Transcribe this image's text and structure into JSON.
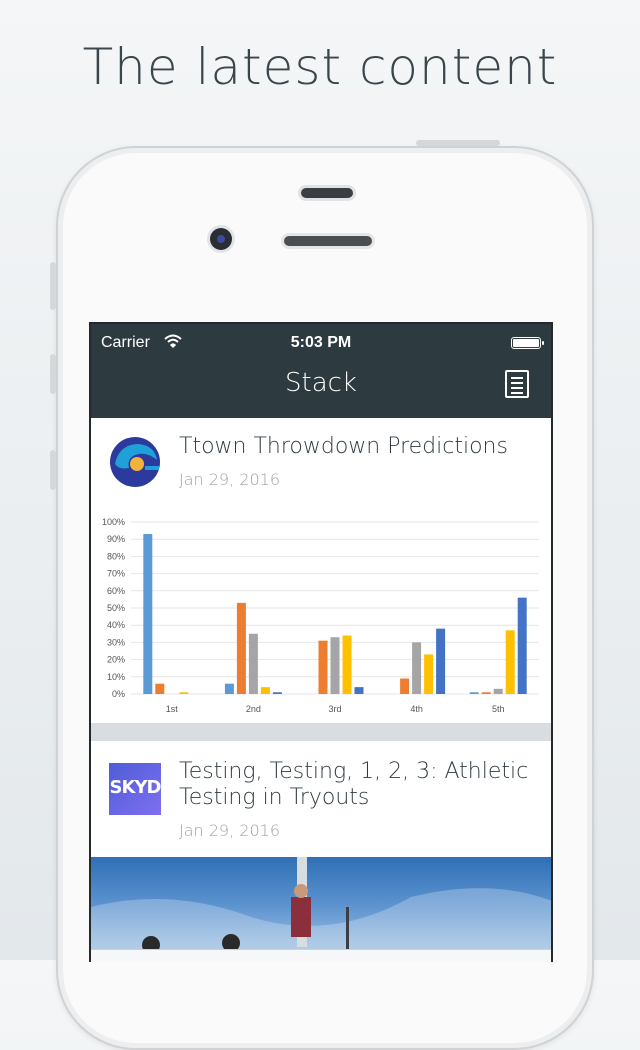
{
  "headline": "The latest content",
  "status_bar": {
    "carrier": "Carrier",
    "time": "5:03 PM"
  },
  "nav": {
    "title": "Stack",
    "right_icon": "list-icon"
  },
  "feed": [
    {
      "title": "Ttown Throwdown Predictions",
      "date": "Jan 29, 2016",
      "logo_icon": "wave-logo-icon"
    },
    {
      "title_line1": "Testing, Testing, 1, 2, 3: Athletic",
      "title_line2": "Testing in Tryouts",
      "date": "Jan 29, 2016",
      "logo_text": "SKYD",
      "image": "ultimate-frisbee-photo"
    }
  ],
  "chart_data": {
    "type": "bar",
    "categories": [
      "1st",
      "2nd",
      "3rd",
      "4th",
      "5th"
    ],
    "series": [
      {
        "values": [
          93,
          6,
          0,
          0,
          1
        ],
        "color": "#5b9bd5"
      },
      {
        "values": [
          6,
          53,
          31,
          9,
          1
        ],
        "color": "#ed7d31"
      },
      {
        "values": [
          0,
          35,
          33,
          30,
          3
        ],
        "color": "#a5a5a5"
      },
      {
        "values": [
          1,
          4,
          34,
          23,
          37
        ],
        "color": "#ffc000"
      },
      {
        "values": [
          0,
          1,
          4,
          38,
          56
        ],
        "color": "#4472c4"
      }
    ],
    "y_ticks": [
      "0%",
      "10%",
      "20%",
      "30%",
      "40%",
      "50%",
      "60%",
      "70%",
      "80%",
      "90%",
      "100%"
    ],
    "ylim": [
      0,
      100
    ],
    "grid": true,
    "legend": "none"
  }
}
